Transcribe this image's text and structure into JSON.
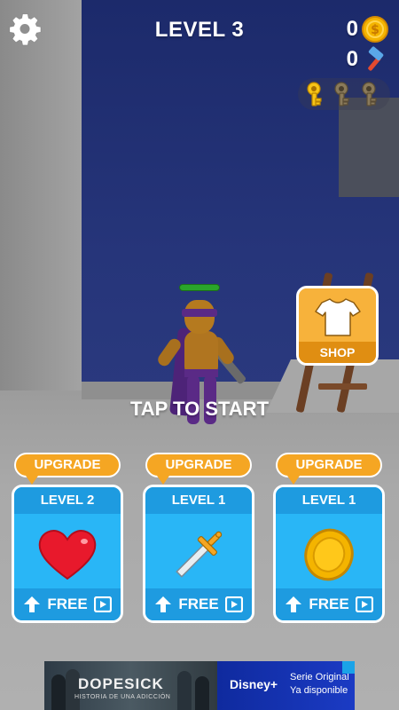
{
  "hud": {
    "level_title": "LEVEL 3",
    "coins": "0",
    "hammers": "0",
    "keys_collected": 1,
    "keys_total": 3
  },
  "shop": {
    "label": "SHOP"
  },
  "prompt": {
    "tap_to_start": "TAP TO START"
  },
  "upgrades": [
    {
      "badge": "UPGRADE",
      "level": "LEVEL 2",
      "icon": "heart-icon",
      "cost": "FREE"
    },
    {
      "badge": "UPGRADE",
      "level": "LEVEL 1",
      "icon": "sword-icon",
      "cost": "FREE"
    },
    {
      "badge": "UPGRADE",
      "level": "LEVEL 1",
      "icon": "coin-icon",
      "cost": "FREE"
    }
  ],
  "ad": {
    "title": "DOPESICK",
    "subtitle": "HISTORIA DE UNA ADICCIÓN",
    "brand": "Disney+",
    "line1": "Serie Original",
    "line2": "Ya disponible"
  },
  "colors": {
    "accent_orange": "#f5a623",
    "upgrade_blue": "#29b6f6",
    "upgrade_blue_dark": "#1e9be0",
    "coin_gold": "#f4b400",
    "key_gold": "#f6c417",
    "key_inactive": "#8a7a5a"
  }
}
